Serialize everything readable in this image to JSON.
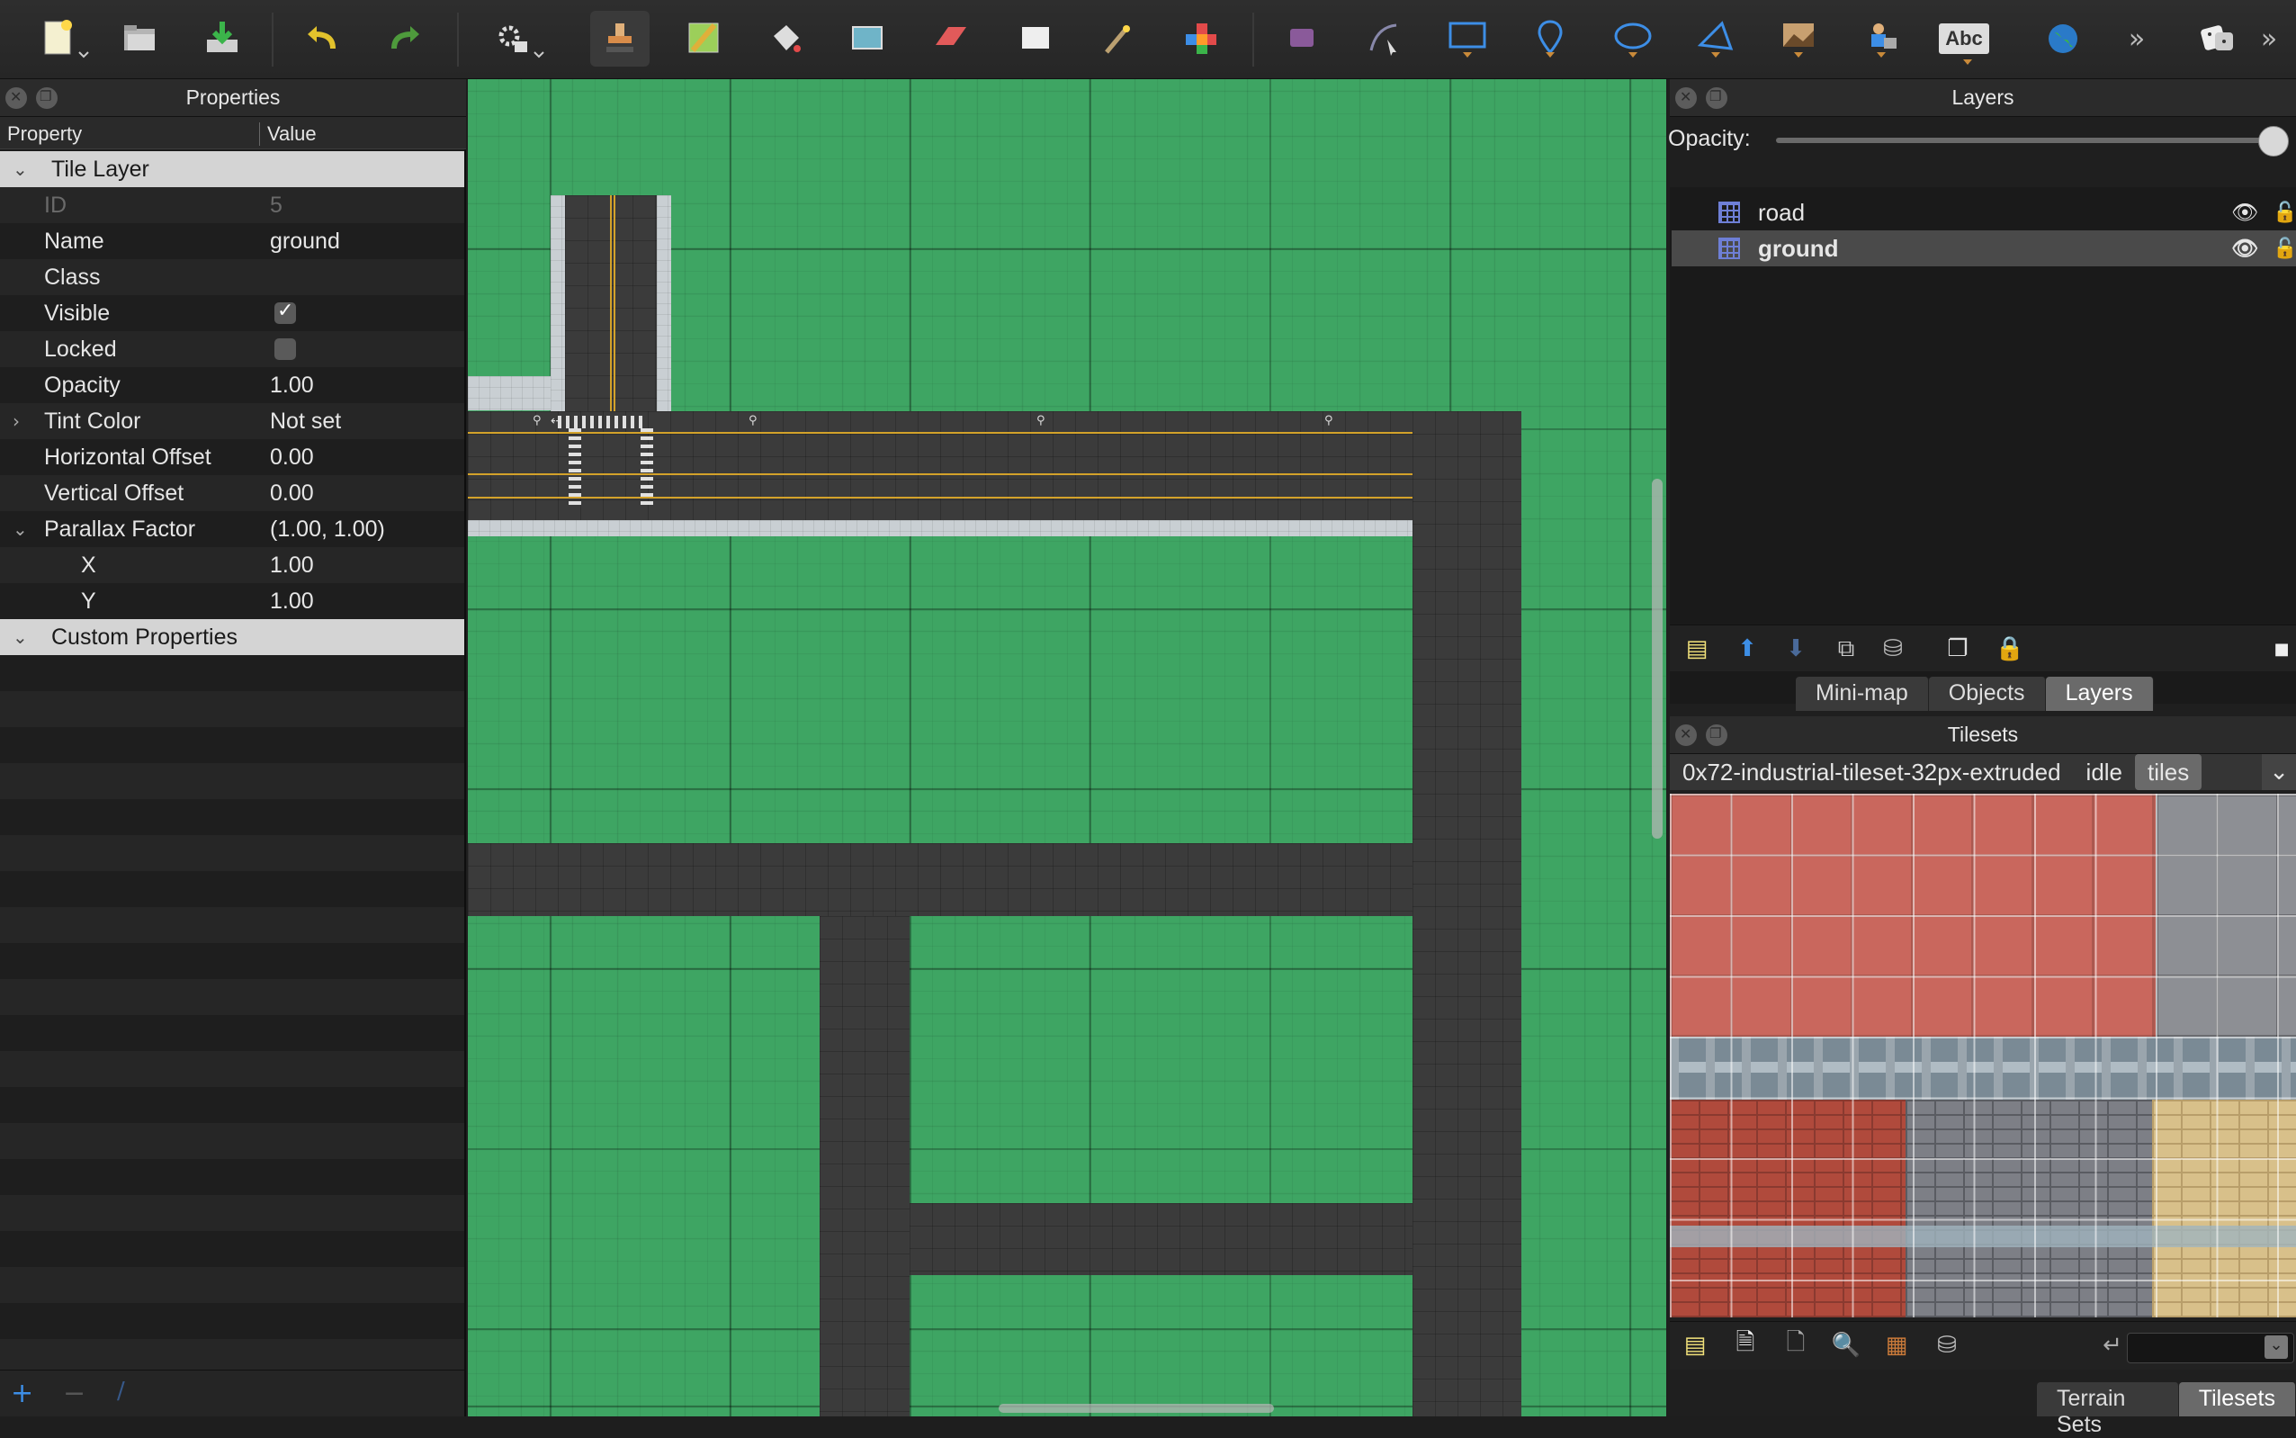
{
  "colors": {
    "accent_blue": "#3d8ee6",
    "map_grass": "#3ea563",
    "road": "#3b3b3b",
    "sidewalk": "#c9cfd3",
    "lane_line": "#d3a22a",
    "brick_red": "#c9675d"
  },
  "toolbar": {
    "icons": [
      "new-map-icon",
      "open-icon",
      "save-icon",
      "undo-icon",
      "redo-icon",
      "automapping-icon",
      "stamp-brush-icon",
      "terrain-brush-icon",
      "bucket-fill-icon",
      "shape-fill-icon",
      "eraser-icon",
      "rectangular-select-icon",
      "magic-wand-icon",
      "select-same-tile-icon",
      "select-objects-icon",
      "edit-polygons-icon",
      "insert-rectangle-icon",
      "insert-point-icon",
      "insert-ellipse-icon",
      "insert-polygon-icon",
      "insert-tile-icon",
      "insert-template-icon",
      "insert-text-icon",
      "world-tool-icon",
      "more-tools-icon",
      "random-mode-icon"
    ],
    "text_tool_label": "Abc"
  },
  "properties": {
    "title": "Properties",
    "col_property": "Property",
    "col_value": "Value",
    "section_tile_layer": "Tile Layer",
    "rows": {
      "id": {
        "label": "ID",
        "value": "5"
      },
      "name": {
        "label": "Name",
        "value": "ground"
      },
      "class": {
        "label": "Class",
        "value": ""
      },
      "visible": {
        "label": "Visible",
        "checked": true
      },
      "locked": {
        "label": "Locked",
        "checked": false
      },
      "opacity": {
        "label": "Opacity",
        "value": "1.00"
      },
      "tint": {
        "label": "Tint Color",
        "value": "Not set"
      },
      "hoffset": {
        "label": "Horizontal Offset",
        "value": "0.00"
      },
      "voffset": {
        "label": "Vertical Offset",
        "value": "0.00"
      },
      "parallax": {
        "label": "Parallax Factor",
        "value": "(1.00, 1.00)"
      },
      "px": {
        "label": "X",
        "value": "1.00"
      },
      "py": {
        "label": "Y",
        "value": "1.00"
      }
    },
    "section_custom": "Custom Properties",
    "footer": {
      "add": "+",
      "remove": "−",
      "rename": "/"
    }
  },
  "layers": {
    "title": "Layers",
    "opacity_label": "Opacity:",
    "opacity_value": 1.0,
    "items": [
      {
        "name": "road",
        "selected": false
      },
      {
        "name": "ground",
        "selected": true
      }
    ],
    "tabs": [
      "Mini-map",
      "Objects",
      "Layers"
    ],
    "active_tab": "Layers"
  },
  "tilesets": {
    "title": "Tilesets",
    "tabs": [
      "0x72-industrial-tileset-32px-extruded",
      "idle",
      "tiles"
    ],
    "active_tab": "tiles",
    "bottom_tabs": [
      "Terrain Sets",
      "Tilesets"
    ],
    "active_bottom_tab": "Tilesets"
  }
}
